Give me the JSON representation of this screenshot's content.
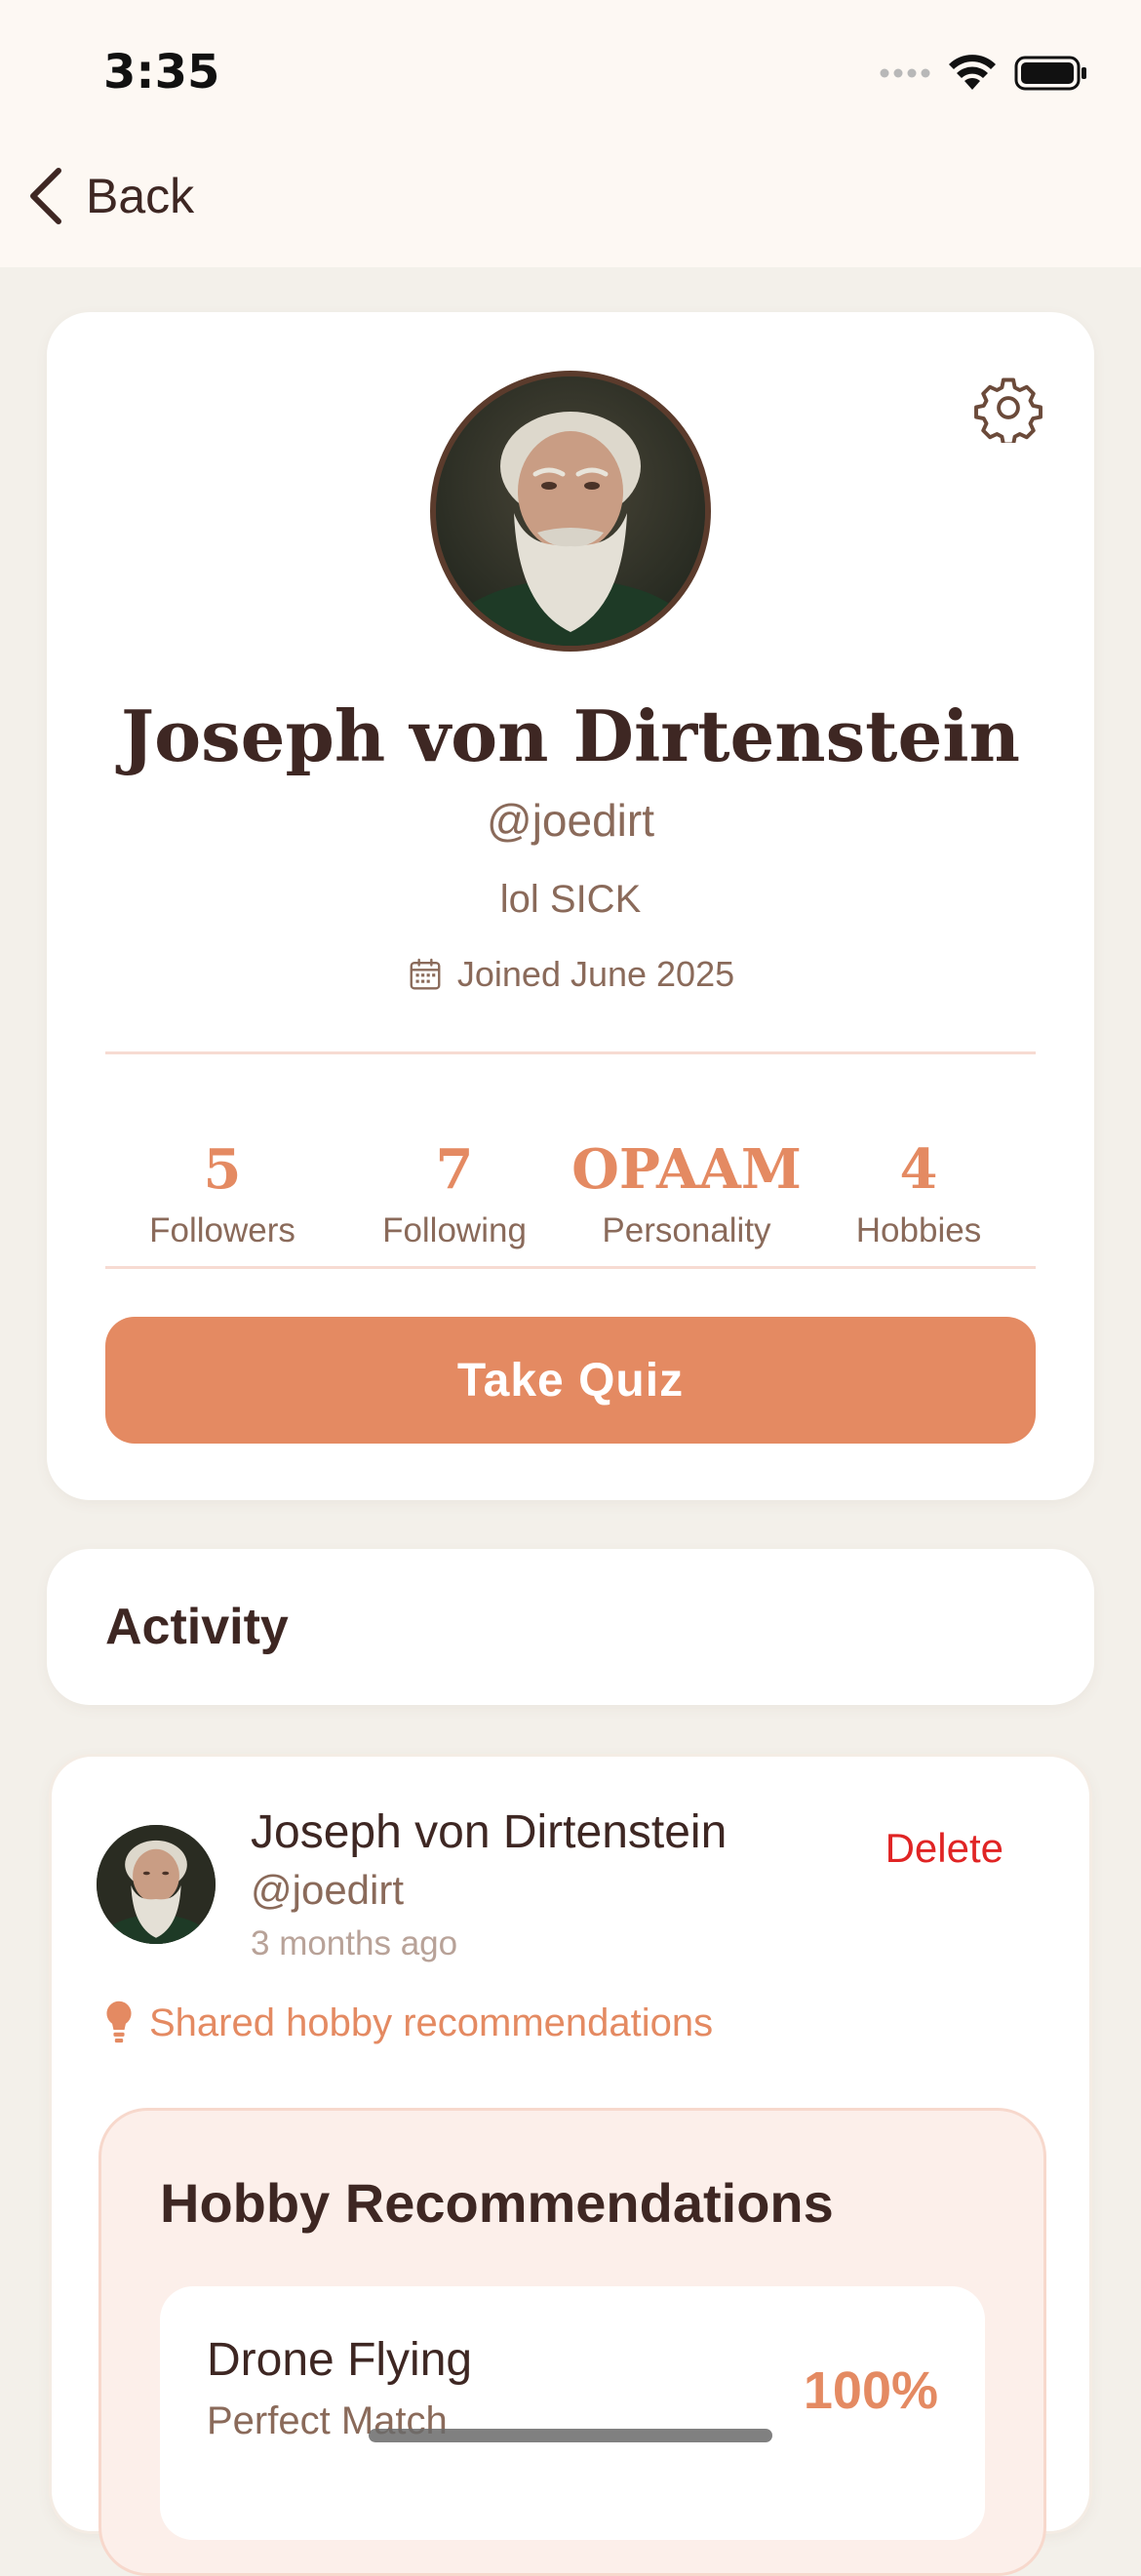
{
  "status_bar": {
    "time": "3:35"
  },
  "nav": {
    "back_label": "Back"
  },
  "profile": {
    "name": "Joseph von Dirtenstein",
    "handle": "@joedirt",
    "bio": "lol SICK",
    "joined": "Joined June 2025",
    "stats": [
      {
        "value": "5",
        "label": "Followers"
      },
      {
        "value": "7",
        "label": "Following"
      },
      {
        "value": "OPAAM",
        "label": "Personality"
      },
      {
        "value": "4",
        "label": "Hobbies"
      }
    ],
    "quiz_button_label": "Take Quiz"
  },
  "activity": {
    "title": "Activity"
  },
  "post": {
    "author": "Joseph von Dirtenstein",
    "handle": "@joedirt",
    "time": "3 months ago",
    "delete_label": "Delete",
    "action": "Shared hobby recommendations",
    "recommendations": {
      "title": "Hobby Recommendations",
      "items": [
        {
          "name": "Drone Flying",
          "match": "Perfect Match",
          "score": "100%"
        }
      ]
    }
  },
  "colors": {
    "accent": "#e48a62",
    "text_dark": "#3e2723",
    "text_muted": "#8a6a5a",
    "delete": "#e02424",
    "background": "#f3f0ea",
    "header_background": "#fdf8f3"
  },
  "icons": {
    "back": "chevron-left-icon",
    "settings": "gear-icon",
    "joined": "calendar-icon",
    "action": "lightbulb-icon"
  }
}
